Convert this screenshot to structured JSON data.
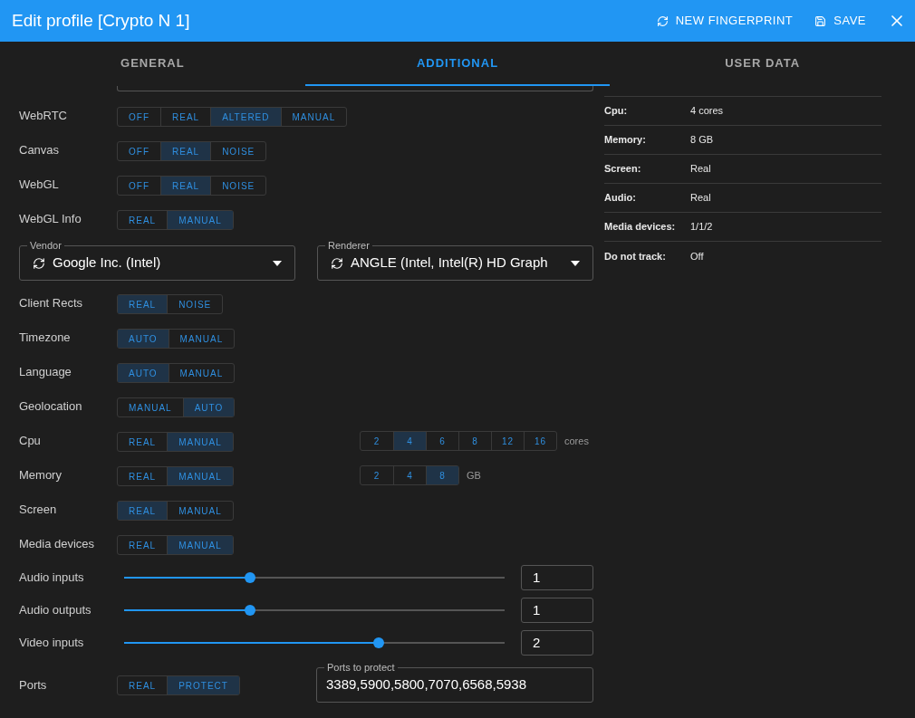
{
  "window": {
    "title": "Edit profile [Crypto N 1]",
    "actions": [
      {
        "kind": "refresh",
        "label": "NEW FINGERPRINT"
      },
      {
        "kind": "save",
        "label": "SAVE"
      }
    ]
  },
  "tabs": [
    {
      "label": "GENERAL",
      "selected": false
    },
    {
      "label": "ADDITIONAL",
      "selected": true
    },
    {
      "label": "USER DATA",
      "selected": false
    }
  ],
  "settings": [
    {
      "kind": "toggle",
      "label": "WebRTC",
      "options": [
        {
          "label": "OFF",
          "selected": false
        },
        {
          "label": "REAL",
          "selected": false
        },
        {
          "label": "ALTERED",
          "selected": true
        },
        {
          "label": "MANUAL",
          "selected": false
        }
      ]
    },
    {
      "kind": "toggle",
      "label": "Canvas",
      "options": [
        {
          "label": "OFF",
          "selected": false
        },
        {
          "label": "REAL",
          "selected": true
        },
        {
          "label": "NOISE",
          "selected": false
        }
      ]
    },
    {
      "kind": "toggle",
      "label": "WebGL",
      "options": [
        {
          "label": "OFF",
          "selected": false
        },
        {
          "label": "REAL",
          "selected": true
        },
        {
          "label": "NOISE",
          "selected": false
        }
      ]
    },
    {
      "kind": "toggle",
      "label": "WebGL Info",
      "options": [
        {
          "label": "REAL",
          "selected": false
        },
        {
          "label": "MANUAL",
          "selected": true
        }
      ]
    },
    {
      "kind": "selects",
      "fields": [
        {
          "label": "Vendor",
          "value": "Google Inc. (Intel)"
        },
        {
          "label": "Renderer",
          "value": "ANGLE (Intel, Intel(R) HD Graph"
        }
      ]
    },
    {
      "kind": "toggle",
      "label": "Client Rects",
      "options": [
        {
          "label": "REAL",
          "selected": true
        },
        {
          "label": "NOISE",
          "selected": false
        }
      ]
    },
    {
      "kind": "toggle",
      "label": "Timezone",
      "options": [
        {
          "label": "AUTO",
          "selected": true
        },
        {
          "label": "MANUAL",
          "selected": false
        }
      ]
    },
    {
      "kind": "toggle",
      "label": "Language",
      "options": [
        {
          "label": "AUTO",
          "selected": true
        },
        {
          "label": "MANUAL",
          "selected": false
        }
      ]
    },
    {
      "kind": "toggle",
      "label": "Geolocation",
      "options": [
        {
          "label": "MANUAL",
          "selected": false
        },
        {
          "label": "AUTO",
          "selected": true
        }
      ]
    },
    {
      "kind": "toggle",
      "label": "Cpu",
      "options": [
        {
          "label": "REAL",
          "selected": false
        },
        {
          "label": "MANUAL",
          "selected": true
        }
      ],
      "choices": {
        "options": [
          {
            "label": "2",
            "selected": false
          },
          {
            "label": "4",
            "selected": true
          },
          {
            "label": "6",
            "selected": false
          },
          {
            "label": "8",
            "selected": false
          },
          {
            "label": "12",
            "selected": false
          },
          {
            "label": "16",
            "selected": false
          }
        ],
        "unit": "cores"
      }
    },
    {
      "kind": "toggle",
      "label": "Memory",
      "options": [
        {
          "label": "REAL",
          "selected": false
        },
        {
          "label": "MANUAL",
          "selected": true
        }
      ],
      "choices": {
        "options": [
          {
            "label": "2",
            "selected": false
          },
          {
            "label": "4",
            "selected": false
          },
          {
            "label": "8",
            "selected": true
          }
        ],
        "unit": "GB"
      }
    },
    {
      "kind": "toggle",
      "label": "Screen",
      "options": [
        {
          "label": "REAL",
          "selected": true
        },
        {
          "label": "MANUAL",
          "selected": false
        }
      ]
    },
    {
      "kind": "toggle",
      "label": "Media devices",
      "options": [
        {
          "label": "REAL",
          "selected": false
        },
        {
          "label": "MANUAL",
          "selected": true
        }
      ]
    },
    {
      "kind": "slider",
      "label": "Audio inputs",
      "level": 0.33,
      "value": "1"
    },
    {
      "kind": "slider",
      "label": "Audio outputs",
      "level": 0.33,
      "value": "1"
    },
    {
      "kind": "slider",
      "label": "Video inputs",
      "level": 0.67,
      "value": "2"
    },
    {
      "kind": "ports",
      "label": "Ports",
      "options": [
        {
          "label": "REAL",
          "selected": false
        },
        {
          "label": "PROTECT",
          "selected": true
        }
      ],
      "field": {
        "label": "Ports to protect",
        "value": "3389,5900,5800,7070,6568,5938"
      }
    }
  ],
  "summary": [
    {
      "label": "Cpu:",
      "value": "4 cores"
    },
    {
      "label": "Memory:",
      "value": "8 GB"
    },
    {
      "label": "Screen:",
      "value": "Real"
    },
    {
      "label": "Audio:",
      "value": "Real"
    },
    {
      "label": "Media devices:",
      "value": "1/1/2"
    },
    {
      "label": "Do not track:",
      "value": "Off"
    }
  ]
}
